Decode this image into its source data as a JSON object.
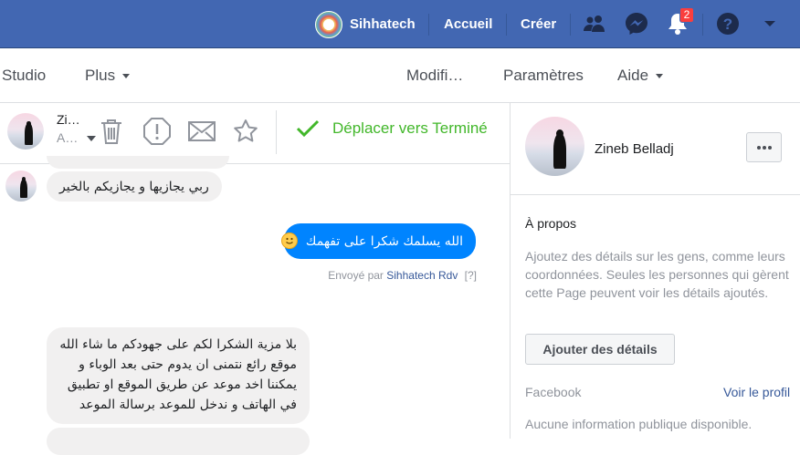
{
  "topbar": {
    "page_name": "Sihhatech",
    "home": "Accueil",
    "create": "Créer",
    "notification_count": "2"
  },
  "subnav": {
    "studio": "Studio",
    "more": "Plus",
    "edit": "Modifi…",
    "settings": "Paramètres",
    "help": "Aide"
  },
  "conversation": {
    "contact_name_short": "Zi…",
    "contact_sub_short": "A…",
    "move_done": "Déplacer vers Terminé",
    "messages": [
      {
        "direction": "in",
        "text": "ربي  يجازيها و يجازيكم بالخير"
      },
      {
        "direction": "out",
        "text": "الله يسلمك شكرا على تفهمك"
      },
      {
        "direction": "in",
        "lines": [
          "بلا مزية الشكرا لكم على جهودكم ما شاء الله",
          "موقع رائع نتمنى ان يدوم حتى بعد الوباء و",
          "يمكننا اخد موعد عن طريق الموقع او تطبيق",
          "في الهاتف و ندخل للموعد برسالة الموعد"
        ]
      }
    ],
    "sent_by_prefix": "Envoyé par",
    "sent_by_name": "Sihhatech Rdv",
    "sent_help": "[?]"
  },
  "profile": {
    "name": "Zineb Belladj",
    "about_title": "À propos",
    "about_text": "Ajoutez des détails sur les gens, comme leurs coordonnées. Seules les personnes qui gèrent cette Page peuvent voir les détails ajoutés.",
    "add_details": "Ajouter des détails",
    "facebook_label": "Facebook",
    "view_profile": "Voir le profil",
    "no_info": "Aucune information publique disponible."
  },
  "colors": {
    "brand_blue": "#4267b2",
    "messenger_blue": "#0084ff",
    "done_green": "#42b72a",
    "badge_red": "#fa3e3e"
  }
}
